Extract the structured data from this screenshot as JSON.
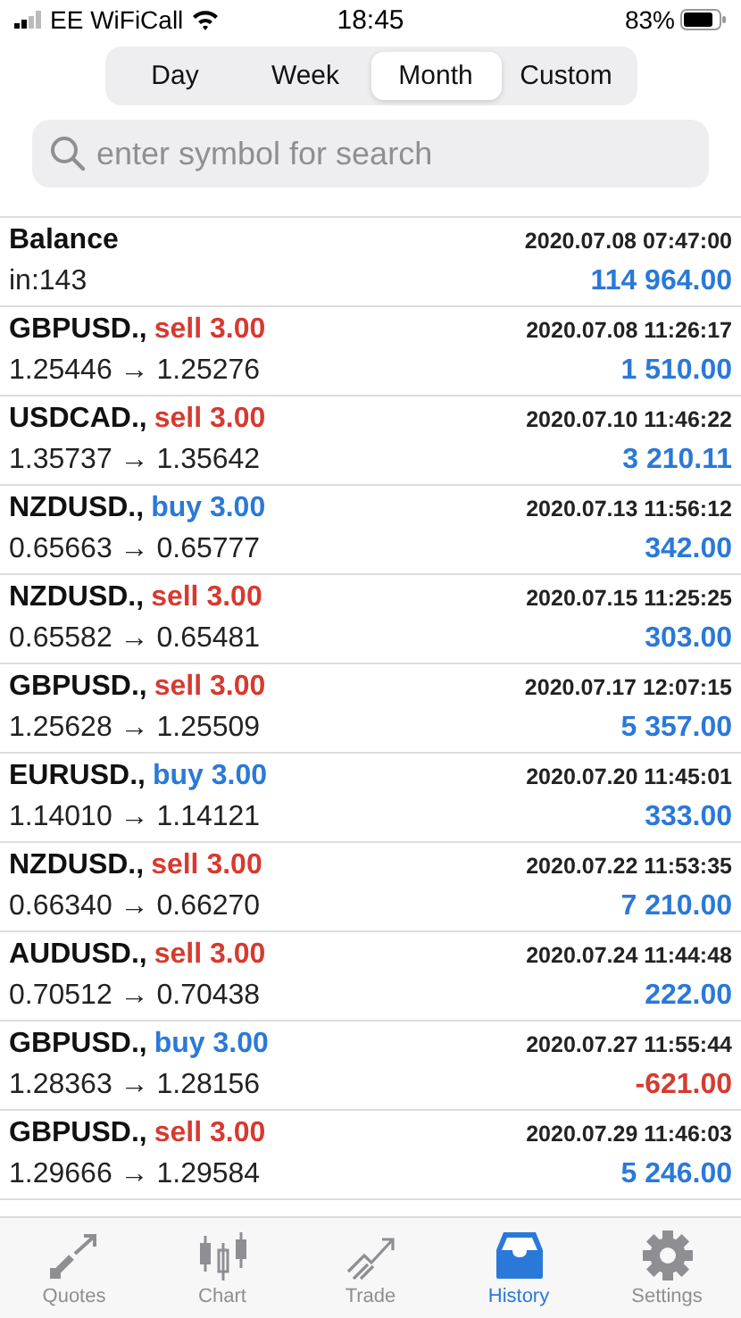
{
  "status_bar": {
    "carrier": "EE WiFiCall",
    "time": "18:45",
    "battery": "83%"
  },
  "periods": [
    {
      "label": "Day",
      "selected": false
    },
    {
      "label": "Week",
      "selected": false
    },
    {
      "label": "Month",
      "selected": true
    },
    {
      "label": "Custom",
      "selected": false
    }
  ],
  "search": {
    "placeholder": "enter symbol for search"
  },
  "rows": [
    {
      "kind": "balance",
      "title": "Balance",
      "detail": "in:143",
      "time": "2020.07.08 07:47:00",
      "amount": "114 964.00",
      "loss": false
    },
    {
      "kind": "deal",
      "symbol": "GBPUSD.,",
      "side": "sell",
      "lots": "3.00",
      "prices": "1.25446 → 1.25276",
      "time": "2020.07.08 11:26:17",
      "amount": "1 510.00",
      "loss": false
    },
    {
      "kind": "deal",
      "symbol": "USDCAD.,",
      "side": "sell",
      "lots": "3.00",
      "prices": "1.35737 → 1.35642",
      "time": "2020.07.10 11:46:22",
      "amount": "3 210.11",
      "loss": false
    },
    {
      "kind": "deal",
      "symbol": "NZDUSD.,",
      "side": "buy",
      "lots": "3.00",
      "prices": "0.65663 → 0.65777",
      "time": "2020.07.13 11:56:12",
      "amount": "342.00",
      "loss": false
    },
    {
      "kind": "deal",
      "symbol": "NZDUSD.,",
      "side": "sell",
      "lots": "3.00",
      "prices": "0.65582 → 0.65481",
      "time": "2020.07.15 11:25:25",
      "amount": "303.00",
      "loss": false
    },
    {
      "kind": "deal",
      "symbol": "GBPUSD.,",
      "side": "sell",
      "lots": "3.00",
      "prices": "1.25628 → 1.25509",
      "time": "2020.07.17 12:07:15",
      "amount": "5 357.00",
      "loss": false
    },
    {
      "kind": "deal",
      "symbol": "EURUSD.,",
      "side": "buy",
      "lots": "3.00",
      "prices": "1.14010 → 1.14121",
      "time": "2020.07.20 11:45:01",
      "amount": "333.00",
      "loss": false
    },
    {
      "kind": "deal",
      "symbol": "NZDUSD.,",
      "side": "sell",
      "lots": "3.00",
      "prices": "0.66340 → 0.66270",
      "time": "2020.07.22 11:53:35",
      "amount": "7 210.00",
      "loss": false
    },
    {
      "kind": "deal",
      "symbol": "AUDUSD.,",
      "side": "sell",
      "lots": "3.00",
      "prices": "0.70512 → 0.70438",
      "time": "2020.07.24 11:44:48",
      "amount": "222.00",
      "loss": false
    },
    {
      "kind": "deal",
      "symbol": "GBPUSD.,",
      "side": "buy",
      "lots": "3.00",
      "prices": "1.28363 → 1.28156",
      "time": "2020.07.27 11:55:44",
      "amount": "-621.00",
      "loss": true
    },
    {
      "kind": "deal",
      "symbol": "GBPUSD.,",
      "side": "sell",
      "lots": "3.00",
      "prices": "1.29666 → 1.29584",
      "time": "2020.07.29 11:46:03",
      "amount": "5 246.00",
      "loss": false
    }
  ],
  "tabs": [
    {
      "kind": "quotes",
      "label": "Quotes",
      "selected": false
    },
    {
      "kind": "chart",
      "label": "Chart",
      "selected": false
    },
    {
      "kind": "trade",
      "label": "Trade",
      "selected": false
    },
    {
      "kind": "history",
      "label": "History",
      "selected": true
    },
    {
      "kind": "settings",
      "label": "Settings",
      "selected": false
    }
  ]
}
